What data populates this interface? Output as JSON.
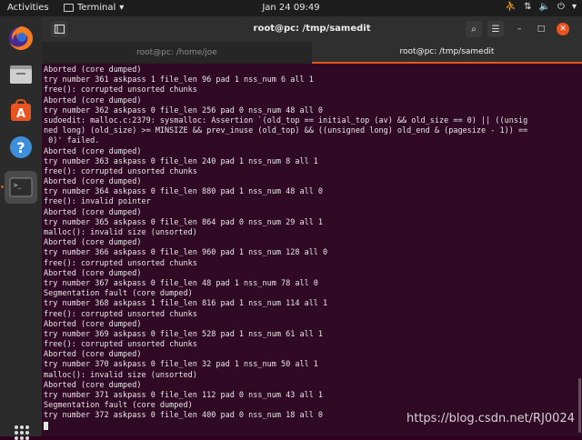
{
  "topbar": {
    "activities": "Activities",
    "app_name": "Terminal",
    "clock": "Jan 24  09:49"
  },
  "window": {
    "title": "root@pc: /tmp/samedit",
    "tabs": [
      {
        "label": "root@pc: /home/joe",
        "active": false
      },
      {
        "label": "root@pc: /tmp/samedit",
        "active": true
      }
    ]
  },
  "terminal": {
    "lines": [
      "Aborted (core dumped)",
      "try number 361 askpass 1 file_len 96 pad 1 nss_num 6 all 1",
      "free(): corrupted unsorted chunks",
      "Aborted (core dumped)",
      "try number 362 askpass 0 file_len 256 pad 0 nss_num 48 all 0",
      "sudoedit: malloc.c:2379: sysmalloc: Assertion `(old_top == initial_top (av) && old_size == 0) || ((unsig",
      "ned long) (old_size) >= MINSIZE && prev_inuse (old_top) && ((unsigned long) old_end & (pagesize - 1)) ==",
      " 0)' failed.",
      "Aborted (core dumped)",
      "try number 363 askpass 0 file_len 240 pad 1 nss_num 8 all 1",
      "free(): corrupted unsorted chunks",
      "Aborted (core dumped)",
      "try number 364 askpass 0 file_len 880 pad 1 nss_num 48 all 0",
      "free(): invalid pointer",
      "Aborted (core dumped)",
      "try number 365 askpass 0 file_len 864 pad 0 nss_num 29 all 1",
      "malloc(): invalid size (unsorted)",
      "Aborted (core dumped)",
      "try number 366 askpass 0 file_len 960 pad 1 nss_num 128 all 0",
      "free(): corrupted unsorted chunks",
      "Aborted (core dumped)",
      "try number 367 askpass 0 file_len 48 pad 1 nss_num 78 all 0",
      "Segmentation fault (core dumped)",
      "try number 368 askpass 1 file_len 816 pad 1 nss_num 114 all 1",
      "free(): corrupted unsorted chunks",
      "Aborted (core dumped)",
      "try number 369 askpass 0 file_len 528 pad 1 nss_num 61 all 1",
      "free(): corrupted unsorted chunks",
      "Aborted (core dumped)",
      "try number 370 askpass 0 file_len 32 pad 1 nss_num 50 all 1",
      "malloc(): invalid size (unsorted)",
      "Aborted (core dumped)",
      "try number 371 askpass 0 file_len 112 pad 0 nss_num 43 all 1",
      "Segmentation fault (core dumped)",
      "try number 372 askpass 0 file_len 400 pad 0 nss_num 18 all 0",
      ""
    ]
  },
  "watermark": "https://blog.csdn.net/RJ0024",
  "colors": {
    "terminal_bg": "#300a24",
    "accent": "#e95420"
  }
}
